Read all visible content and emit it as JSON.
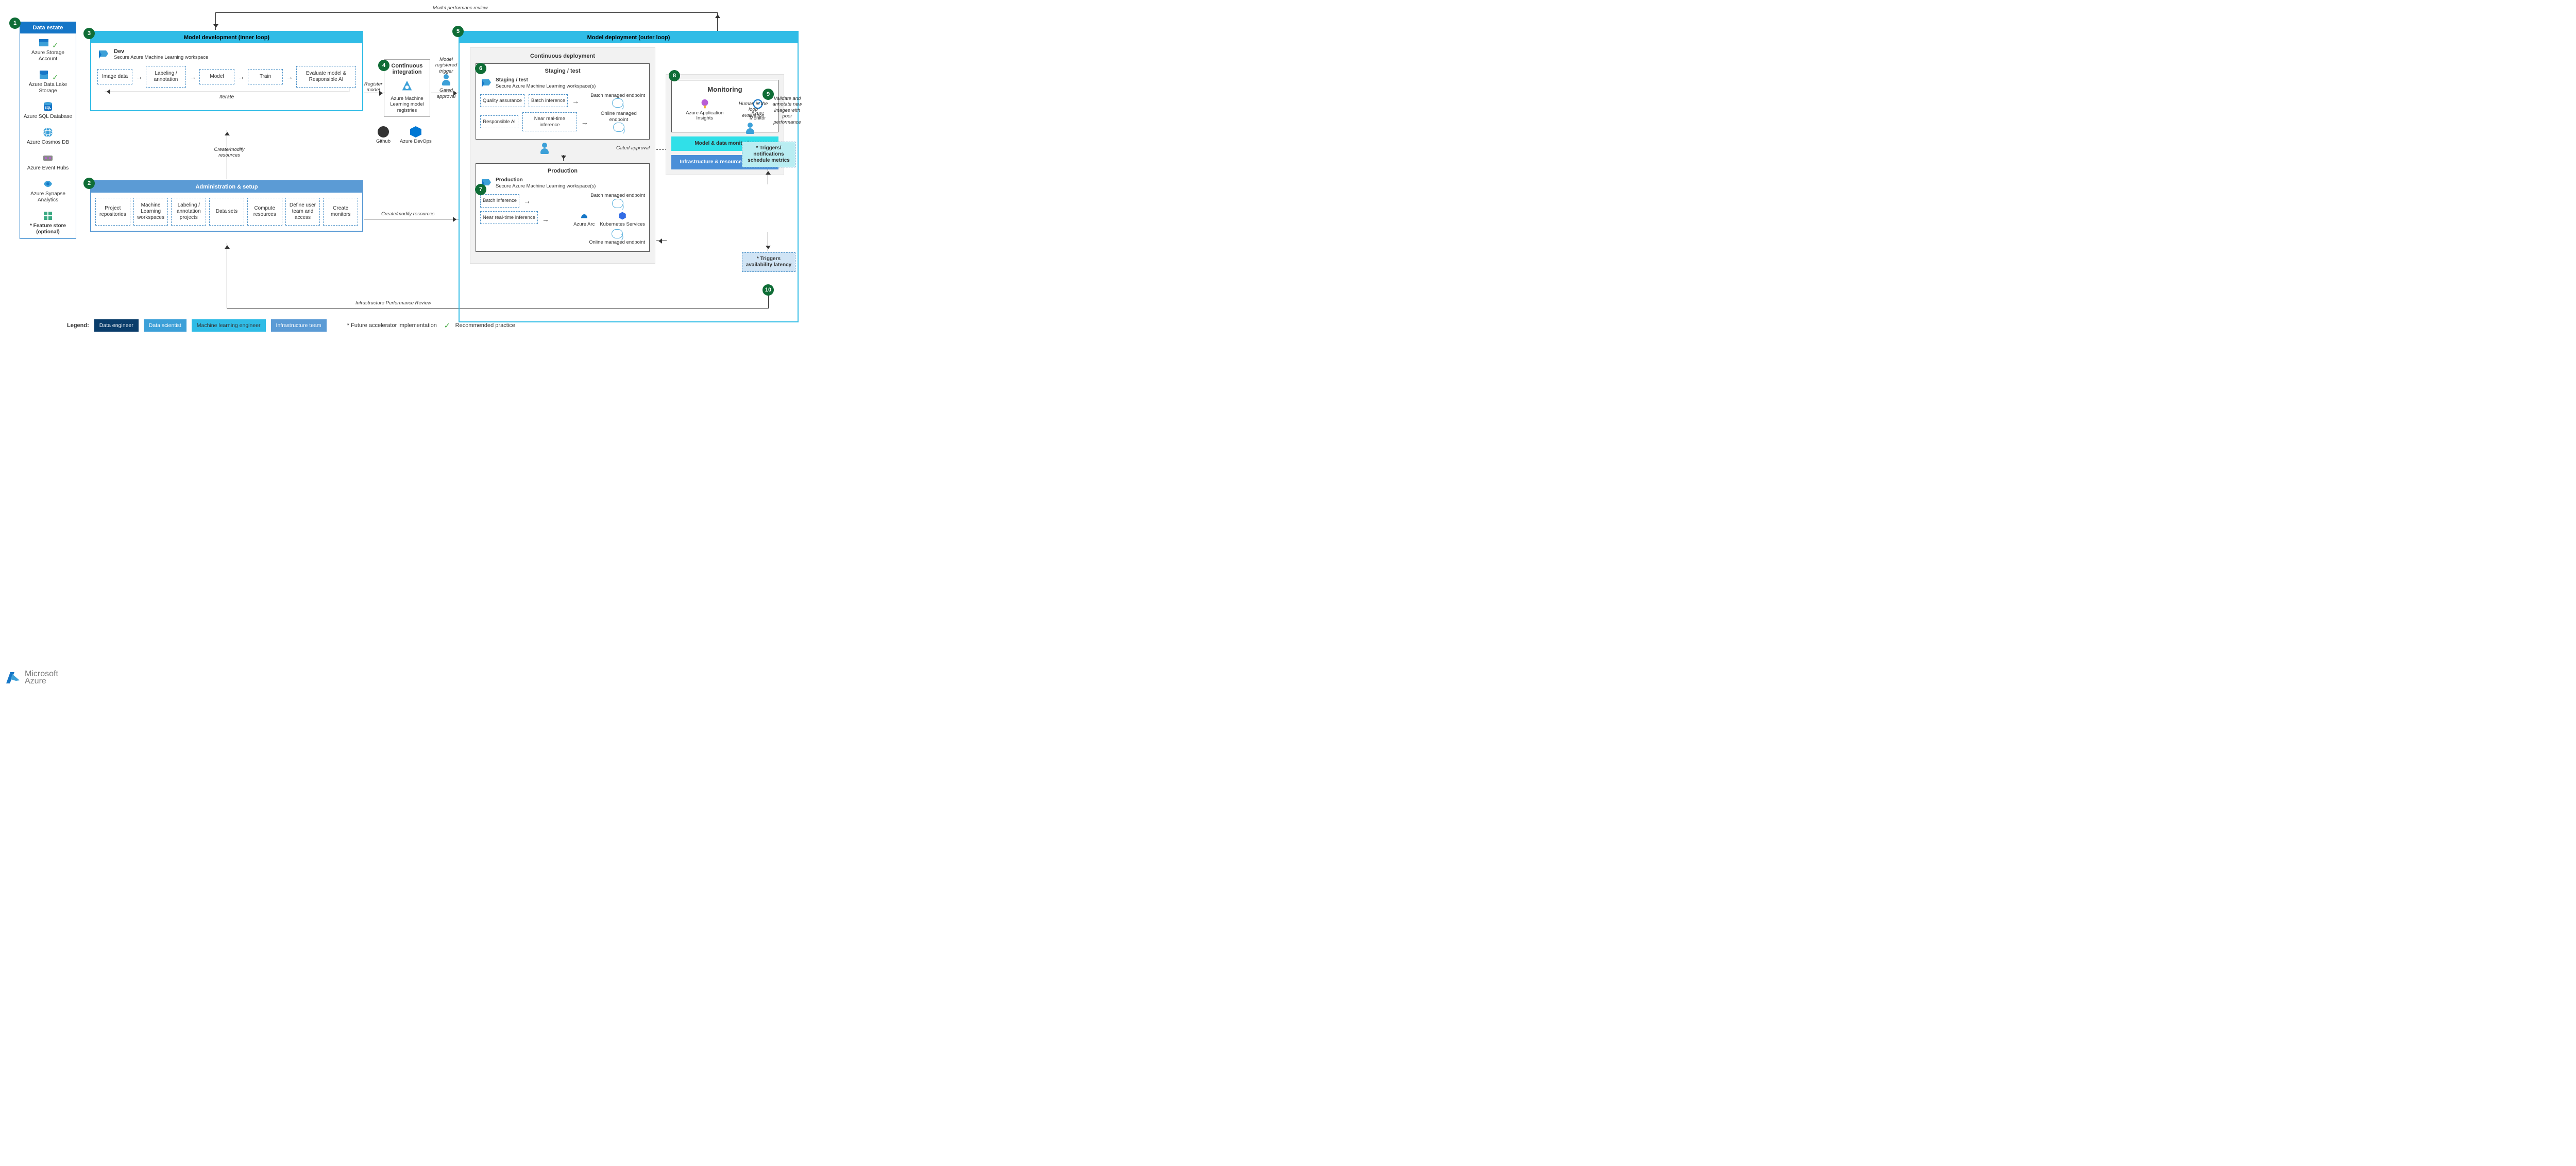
{
  "steps": [
    "1",
    "2",
    "3",
    "4",
    "5",
    "6",
    "7",
    "8",
    "9",
    "10"
  ],
  "dataEstate": {
    "header": "Data estate",
    "items": [
      {
        "label": "Azure Storage Account",
        "check": true
      },
      {
        "label": "Azure Data Lake Storage",
        "check": true
      },
      {
        "label": "Azure SQL Database"
      },
      {
        "label": "Azure Cosmos DB"
      },
      {
        "label": "Azure Event Hubs"
      },
      {
        "label": "Azure Synapse Analytics"
      },
      {
        "label": "* Feature store (optional)",
        "bold": true
      }
    ]
  },
  "modelDev": {
    "header": "Model development (inner loop)",
    "env": {
      "title": "Dev",
      "sub": "Secure Azure Machine Learning workspace"
    },
    "flow": [
      "Image data",
      "Labeling / annotation",
      "Model",
      "Train",
      "Evaluate model & Responsible AI"
    ],
    "iterate": "Iterate"
  },
  "between": {
    "createModify": "Create/modify resources",
    "registerModel": "Register model",
    "createModifyRes": "Create/modify resources",
    "modelPerfReview": "Model performanc review",
    "infraPerfReview": "Infrastructure Performance Review",
    "modelRegTrigger": "Model registered trigger",
    "gatedApproval": "Gated approval",
    "gatedApproval2": "Gated approval",
    "humanLoop": "Human in the loop evaluation",
    "validateAnnotate": "Validate and annotate new images with poor performance"
  },
  "ci": {
    "title": "Continuous integration",
    "sub": "Azure Machine Learning model registries",
    "sources": [
      {
        "name": "Github"
      },
      {
        "name": "Azure DevOps"
      }
    ]
  },
  "admin": {
    "header": "Administration & setup",
    "items": [
      "Project repositories",
      "Machine Learning workspaces",
      "Labeling / annotation projects",
      "Data sets",
      "Compute resources",
      "Define user team and access",
      "Create monitors"
    ]
  },
  "modelDep": {
    "header": "Model deployment (outer loop)",
    "cd": {
      "title": "Continuous deployment"
    },
    "staging": {
      "title": "Staging / test",
      "env": {
        "title": "Staging / test",
        "sub": "Secure Azure Machine Learning workspace(s)"
      },
      "rows": [
        [
          "Quality assurance",
          "Batch inference"
        ],
        [
          "Responsible AI",
          "Near real-time inference"
        ]
      ],
      "endpoints": [
        "Batch managed endpoint",
        "Online managed endpoint"
      ]
    },
    "prod": {
      "title": "Production",
      "env": {
        "title": "Production",
        "sub": "Secure Azure Machine Learning workspace(s)"
      },
      "rows": [
        "Batch inference",
        "Near real-time inference"
      ],
      "endpoints": [
        "Batch managed endpoint",
        "Online managed endpoint"
      ],
      "services": [
        "Azure Arc",
        "Kubernetes Services"
      ]
    },
    "monitoring": {
      "title": "Monitoring",
      "tools": [
        "Azure Application Insights",
        "Azure Monitor"
      ],
      "cards": [
        "Model & data monitoring",
        "Infrastructure & resource monitoring"
      ]
    },
    "triggers": {
      "notif": "* Triggers/ notifications schedule metrics",
      "avail": "* Triggers availability latency"
    }
  },
  "legend": {
    "label": "Legend:",
    "roles": [
      "Data engineer",
      "Data scientist",
      "Machine learning engineer",
      "Infrastructure team"
    ],
    "future": "* Future accelerator implementation",
    "recommended": "Recommended practice"
  },
  "brand": {
    "name": "Microsoft",
    "product": "Azure"
  }
}
